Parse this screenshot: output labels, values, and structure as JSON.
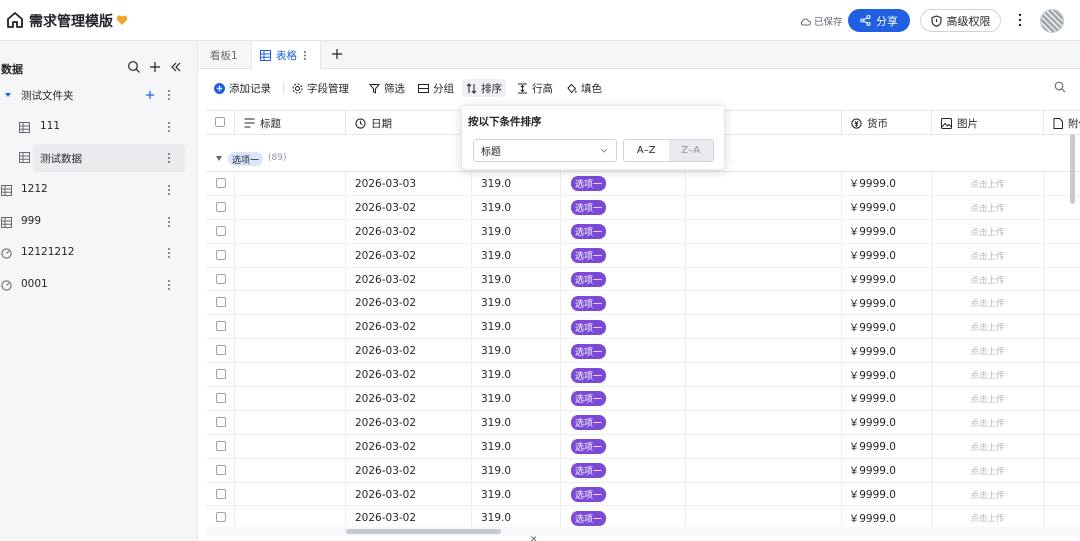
{
  "app": {
    "title": "需求管理模版",
    "saved_status": "已保存",
    "share_label": "分享",
    "permission_label": "高级权限"
  },
  "colors": {
    "primary": "#1f5fe0",
    "option_tag": "#7b4bd8",
    "group_badge": "#dbe5fb",
    "heart": "#f0a732"
  },
  "sidebar": {
    "title": "数据",
    "items": [
      {
        "label": "测试文件夹",
        "icon": "folder-caret-icon",
        "level": 0
      },
      {
        "label": "111",
        "icon": "table-icon",
        "level": 1
      },
      {
        "label": "测试数据",
        "icon": "table-icon",
        "level": 1,
        "active": true
      },
      {
        "label": "1212",
        "icon": "table-icon",
        "level": 0
      },
      {
        "label": "999",
        "icon": "table-icon",
        "level": 0
      },
      {
        "label": "12121212",
        "icon": "gauge-icon",
        "level": 0
      },
      {
        "label": "0001",
        "icon": "gauge-icon",
        "level": 0
      }
    ]
  },
  "tabs": [
    {
      "label": "看板1"
    },
    {
      "label": "表格",
      "active": true
    }
  ],
  "toolbar": {
    "add_record": "添加记录",
    "field_manage": "字段管理",
    "filter": "筛选",
    "group": "分组",
    "sort": "排序",
    "row_height": "行高",
    "fill_color": "填色"
  },
  "table": {
    "columns": [
      "标题",
      "日期",
      "",
      "",
      "",
      "货币",
      "图片",
      "附件"
    ],
    "group": {
      "label": "选项一",
      "count": "(89)"
    },
    "rows": [
      {
        "date": "2026-03-03",
        "num": "319.0",
        "option": "选项一",
        "currency": "￥9999.0",
        "image": "点击上传"
      },
      {
        "date": "2026-03-02",
        "num": "319.0",
        "option": "选项一",
        "currency": "￥9999.0",
        "image": "点击上传"
      },
      {
        "date": "2026-03-02",
        "num": "319.0",
        "option": "选项一",
        "currency": "￥9999.0",
        "image": "点击上传"
      },
      {
        "date": "2026-03-02",
        "num": "319.0",
        "option": "选项一",
        "currency": "￥9999.0",
        "image": "点击上传"
      },
      {
        "date": "2026-03-02",
        "num": "319.0",
        "option": "选项一",
        "currency": "￥9999.0",
        "image": "点击上传"
      },
      {
        "date": "2026-03-02",
        "num": "319.0",
        "option": "选项一",
        "currency": "￥9999.0",
        "image": "点击上传"
      },
      {
        "date": "2026-03-02",
        "num": "319.0",
        "option": "选项一",
        "currency": "￥9999.0",
        "image": "点击上传"
      },
      {
        "date": "2026-03-02",
        "num": "319.0",
        "option": "选项一",
        "currency": "￥9999.0",
        "image": "点击上传"
      },
      {
        "date": "2026-03-02",
        "num": "319.0",
        "option": "选项一",
        "currency": "￥9999.0",
        "image": "点击上传"
      },
      {
        "date": "2026-03-02",
        "num": "319.0",
        "option": "选项一",
        "currency": "￥9999.0",
        "image": "点击上传"
      },
      {
        "date": "2026-03-02",
        "num": "319.0",
        "option": "选项一",
        "currency": "￥9999.0",
        "image": "点击上传"
      },
      {
        "date": "2026-03-02",
        "num": "319.0",
        "option": "选项一",
        "currency": "￥9999.0",
        "image": "点击上传"
      },
      {
        "date": "2026-03-02",
        "num": "319.0",
        "option": "选项一",
        "currency": "￥9999.0",
        "image": "点击上传"
      },
      {
        "date": "2026-03-02",
        "num": "319.0",
        "option": "选项一",
        "currency": "￥9999.0",
        "image": "点击上传"
      },
      {
        "date": "2026-03-02",
        "num": "319.0",
        "option": "选项一",
        "currency": "￥9999.0",
        "image": "点击上传"
      }
    ]
  },
  "sort_popup": {
    "title": "按以下条件排序",
    "field": "标题",
    "asc": "A–Z",
    "desc": "Z–A"
  }
}
